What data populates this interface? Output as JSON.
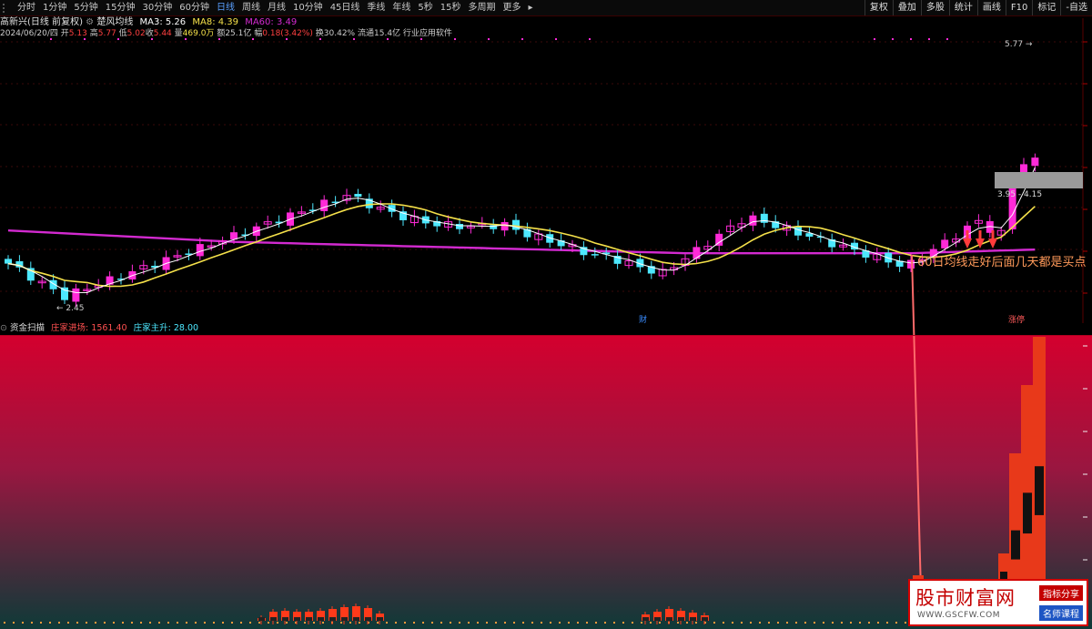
{
  "toolbar": {
    "periods": [
      "分时",
      "1分钟",
      "5分钟",
      "15分钟",
      "30分钟",
      "60分钟",
      "日线",
      "周线",
      "月线",
      "10分钟",
      "45日线",
      "季线",
      "年线",
      "5秒",
      "15秒",
      "多周期",
      "更多"
    ],
    "active_index": 6,
    "right_buttons": [
      "复权",
      "叠加",
      "多股",
      "统计",
      "画线",
      "F10",
      "标记",
      "-自选"
    ]
  },
  "stock": {
    "title": "高新兴(日线 前复权)",
    "indicator_name": "楚风均线",
    "ma3": "MA3: 5.26",
    "ma8": "MA8: 4.39",
    "ma60": "MA60: 3.49"
  },
  "quote": {
    "date": "2024/06/20/四",
    "open_label": "开",
    "open": "5.13",
    "high_label": "高",
    "high": "5.77",
    "low_label": "低",
    "low": "5.02",
    "close_label": "收",
    "close": "5.44",
    "volume_label": "量",
    "volume": "469.0万",
    "amount_label": "额",
    "amount": "25.1亿",
    "change_label": "幅",
    "change": "0.18(3.42%)",
    "turnover": "换30.42%",
    "float": "流通15.4亿",
    "industry": "行业应用软件"
  },
  "chart_labels": {
    "price_high": "5.77",
    "price_low": "2.45",
    "range_label": "3.95 - 4.15",
    "annotation": "60日均线走好后面几天都是买点",
    "marker_cai": "财",
    "marker_zhangting": "涨停"
  },
  "pane2": {
    "title": "资金扫描",
    "label1": "庄家进场:",
    "value1": "1561.40",
    "label2": "庄家主升:",
    "value2": "28.00"
  },
  "colors": {
    "up": "#ff2ad8",
    "down": "#4de8ff",
    "ma_fast": "#ffffff",
    "ma_slow": "#f5e14a",
    "ma60": "#d32ad0",
    "gradient_top": "#d4002e",
    "gradient_bottom": "#0e3a38",
    "active_tab": "#5aa0ff"
  },
  "watermark": {
    "brand": "股市财富网",
    "url": "WWW.GSCFW.COM",
    "tag1": "指标分享",
    "tag2": "名师课程"
  }
}
